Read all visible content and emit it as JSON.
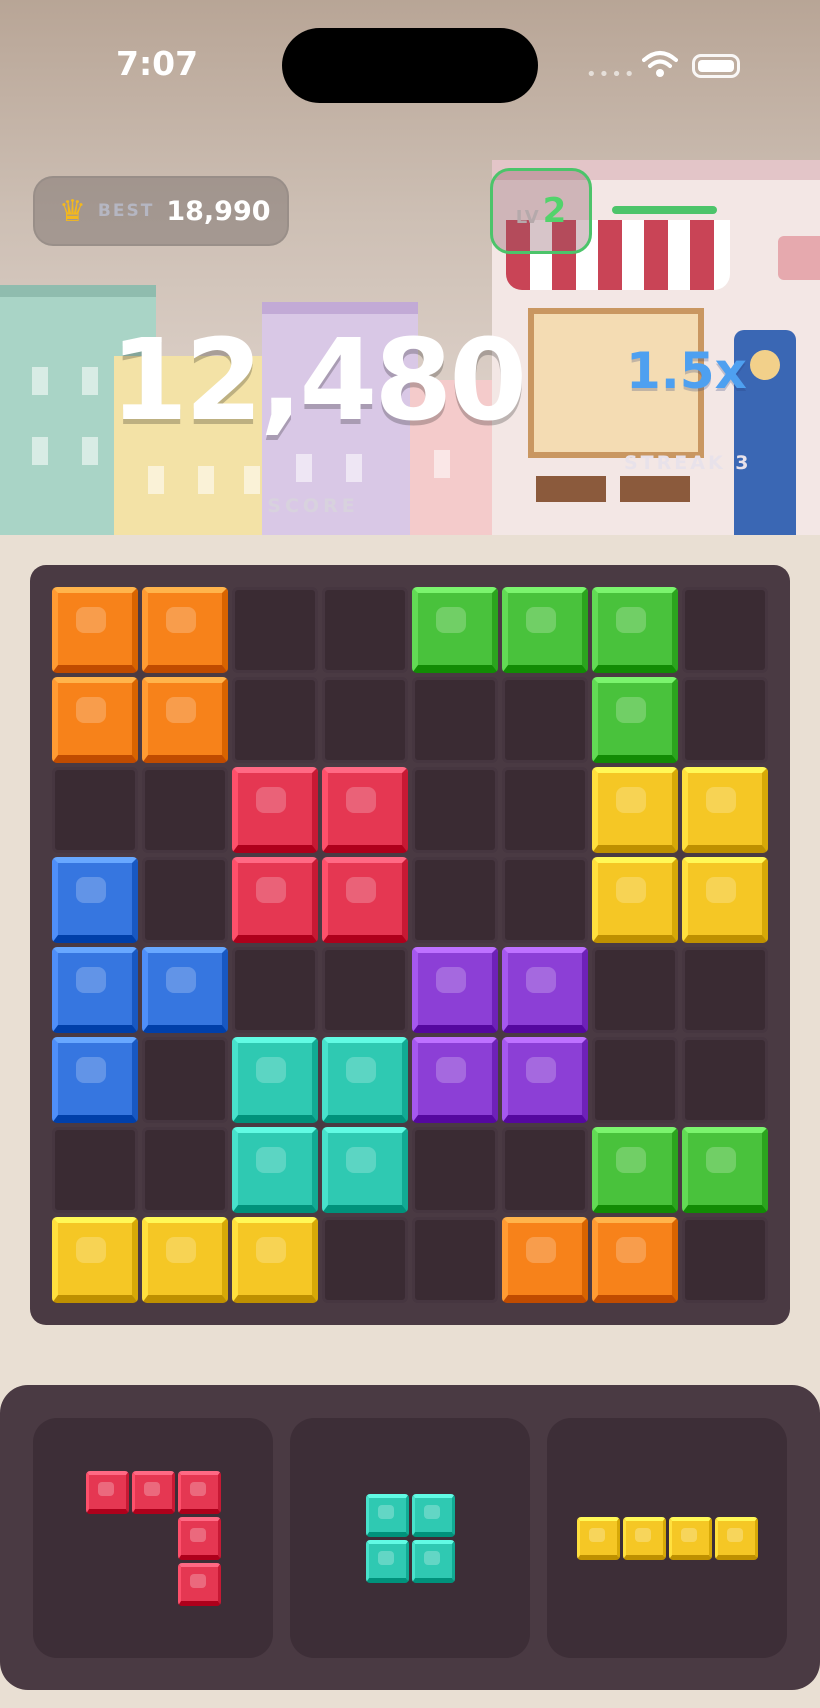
{
  "status_bar": {
    "time": "7:07"
  },
  "best": {
    "label": "BEST",
    "value": "18,990"
  },
  "level": {
    "label": "LV",
    "value": "2",
    "progress": 0.85
  },
  "score": {
    "value": "12,480",
    "label": "SCORE"
  },
  "multiplier": {
    "value": "1.5x",
    "streak": "STREAK 3"
  },
  "colors": {
    "orange": "#f7821a",
    "green": "#49c23c",
    "red": "#e53752",
    "yellow": "#f5c725",
    "blue": "#3676e0",
    "purple": "#8c3fd6",
    "teal": "#2fc9b2"
  },
  "board": {
    "rows": [
      [
        "orange",
        "orange",
        "",
        "",
        "green",
        "green",
        "green",
        ""
      ],
      [
        "orange",
        "orange",
        "",
        "",
        "",
        "",
        "green",
        ""
      ],
      [
        "",
        "",
        "red",
        "red",
        "",
        "",
        "yellow",
        "yellow"
      ],
      [
        "blue",
        "",
        "red",
        "red",
        "",
        "",
        "yellow",
        "yellow"
      ],
      [
        "blue",
        "blue",
        "",
        "",
        "purple",
        "purple",
        "",
        ""
      ],
      [
        "blue",
        "",
        "teal",
        "teal",
        "purple",
        "purple",
        "",
        ""
      ],
      [
        "",
        "",
        "teal",
        "teal",
        "",
        "",
        "green",
        "green"
      ],
      [
        "yellow",
        "yellow",
        "yellow",
        "",
        "",
        "orange",
        "orange",
        ""
      ]
    ]
  },
  "tray": {
    "pieces": [
      {
        "name": "red-j-piece",
        "color": "red",
        "cells": [
          [
            0,
            0
          ],
          [
            0,
            1
          ],
          [
            0,
            2
          ],
          [
            1,
            2
          ],
          [
            2,
            2
          ]
        ]
      },
      {
        "name": "teal-square-piece",
        "color": "teal",
        "cells": [
          [
            0,
            0
          ],
          [
            0,
            1
          ],
          [
            1,
            0
          ],
          [
            1,
            1
          ]
        ]
      },
      {
        "name": "yellow-line-piece",
        "color": "yellow",
        "cells": [
          [
            0,
            0
          ],
          [
            0,
            1
          ],
          [
            0,
            2
          ],
          [
            0,
            3
          ]
        ]
      }
    ]
  }
}
